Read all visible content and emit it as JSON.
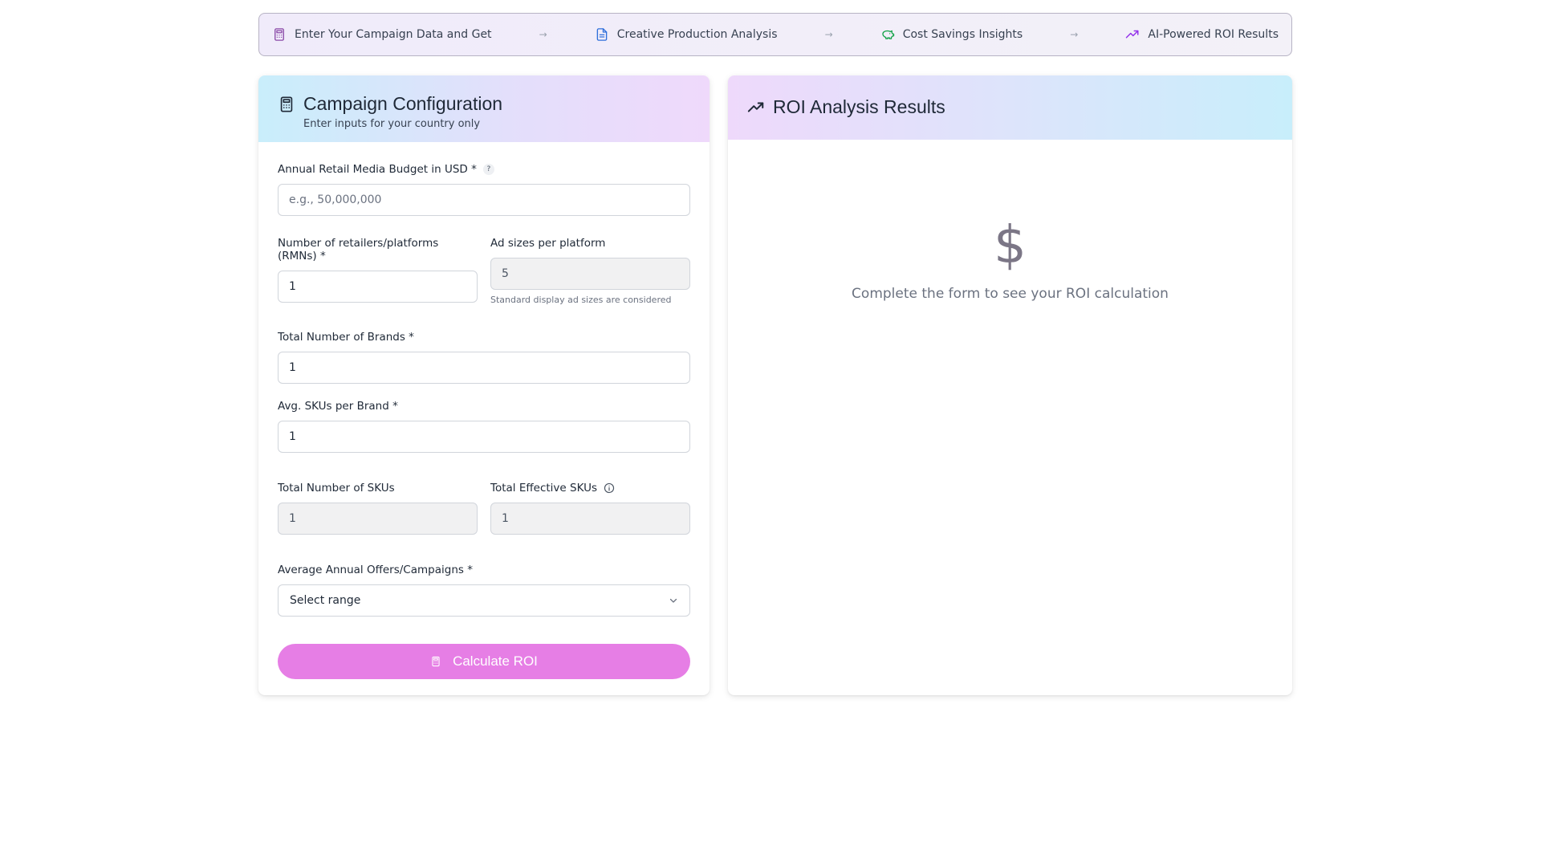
{
  "steps": [
    {
      "label": "Enter Your Campaign Data and Get",
      "icon": "calculator-icon"
    },
    {
      "label": "Creative Production Analysis",
      "icon": "document-icon"
    },
    {
      "label": "Cost Savings Insights",
      "icon": "piggy-bank-icon"
    },
    {
      "label": "AI-Powered ROI Results",
      "icon": "trending-up-icon"
    }
  ],
  "step_arrow": "→",
  "config": {
    "title": "Campaign Configuration",
    "subtitle": "Enter inputs for your country only",
    "budget": {
      "label": "Annual Retail Media Budget in USD *",
      "help": "?",
      "placeholder": "e.g., 50,000,000",
      "value": ""
    },
    "retailers": {
      "label": "Number of retailers/platforms (RMNs) *",
      "value": "1"
    },
    "ad_sizes": {
      "label": "Ad sizes per platform",
      "value": "5",
      "hint": "Standard display ad sizes are considered"
    },
    "brands": {
      "label": "Total Number of Brands *",
      "value": "1"
    },
    "skus_per_brand": {
      "label": "Avg. SKUs per Brand *",
      "value": "1"
    },
    "total_skus": {
      "label": "Total Number of SKUs",
      "value": "1"
    },
    "effective_skus": {
      "label": "Total Effective SKUs",
      "value": "1"
    },
    "offers": {
      "label": "Average Annual Offers/Campaigns *",
      "selected": "Select range"
    },
    "calculate_label": "Calculate ROI"
  },
  "results": {
    "title": "ROI Analysis Results",
    "empty_symbol": "$",
    "empty_text": "Complete the form to see your ROI calculation"
  },
  "colors": {
    "accent_button": "#e67ee5",
    "step_calc": "#8b4aa8",
    "step_doc": "#2f6fdb",
    "step_piggy": "#16a34a",
    "step_trend": "#9333ea"
  }
}
